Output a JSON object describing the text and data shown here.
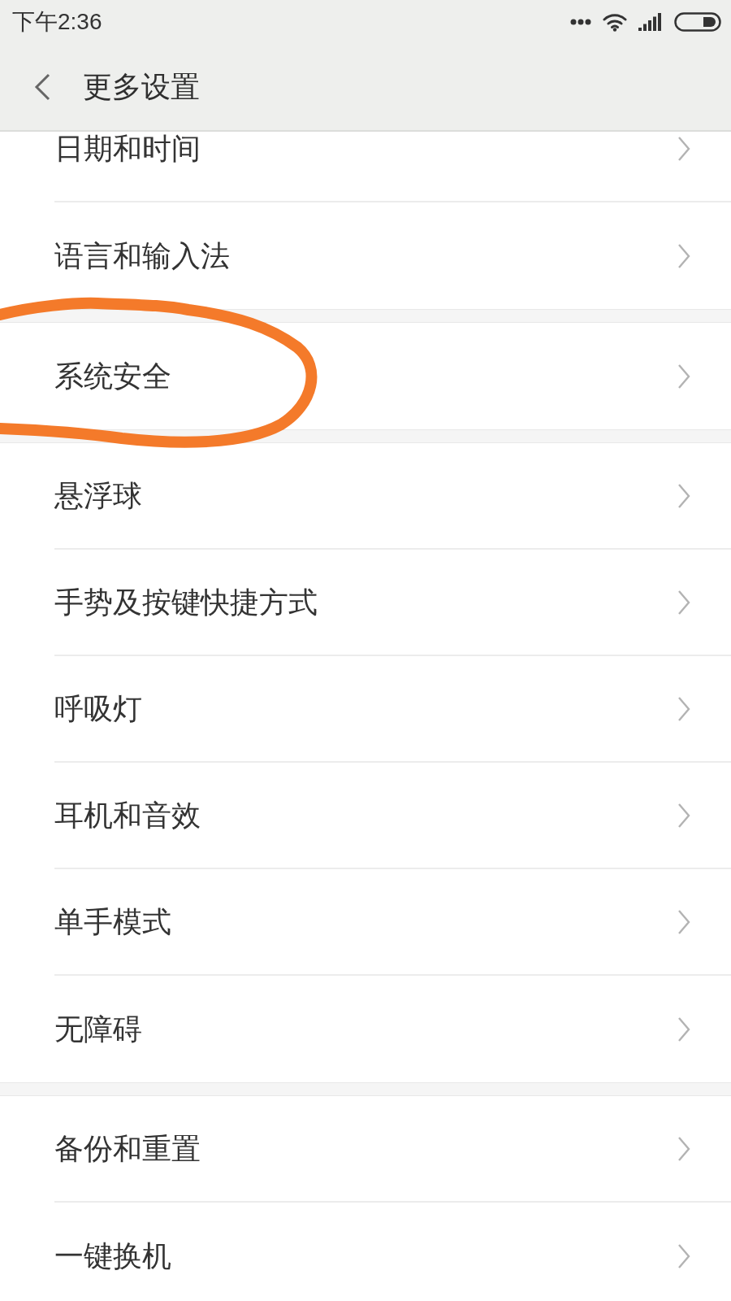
{
  "status_bar": {
    "time": "下午2:36"
  },
  "header": {
    "title": "更多设置"
  },
  "groups": [
    {
      "items": [
        {
          "label": "日期和时间",
          "circled": false
        },
        {
          "label": "语言和输入法",
          "circled": false
        }
      ]
    },
    {
      "items": [
        {
          "label": "系统安全",
          "circled": true
        }
      ]
    },
    {
      "items": [
        {
          "label": "悬浮球",
          "circled": false
        },
        {
          "label": "手势及按键快捷方式",
          "circled": false
        },
        {
          "label": "呼吸灯",
          "circled": false
        },
        {
          "label": "耳机和音效",
          "circled": false
        },
        {
          "label": "单手模式",
          "circled": false
        },
        {
          "label": "无障碍",
          "circled": false
        }
      ]
    },
    {
      "items": [
        {
          "label": "备份和重置",
          "circled": false
        },
        {
          "label": "一键换机",
          "circled": false
        }
      ]
    }
  ]
}
